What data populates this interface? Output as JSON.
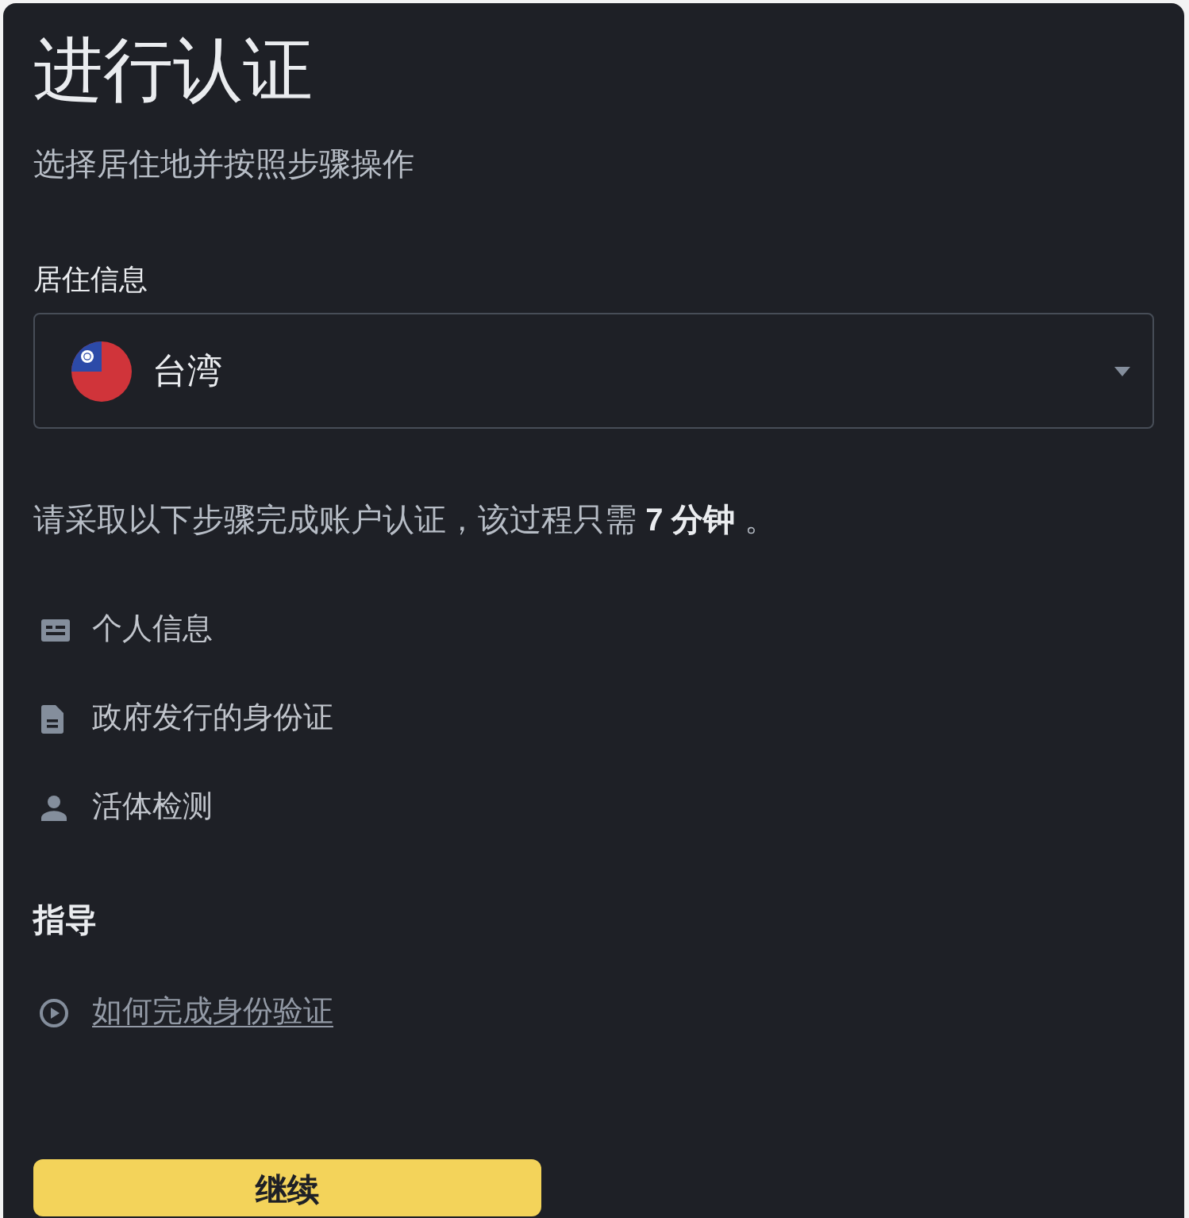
{
  "page": {
    "title": "进行认证",
    "subtitle": "选择居住地并按照步骤操作"
  },
  "residence": {
    "label": "居住信息",
    "select": {
      "value": "台湾"
    }
  },
  "intro": "请采取以下步骤完成账户认证，该过程只需 **7 分钟** 。",
  "steps": [
    {
      "kind": "card",
      "label": "个人信息"
    },
    {
      "kind": "document",
      "label": "政府发行的身份证"
    },
    {
      "kind": "person",
      "label": "活体检测"
    }
  ],
  "guide": {
    "heading": "指导",
    "link": "如何完成身份验证"
  },
  "continue_button": "继续"
}
